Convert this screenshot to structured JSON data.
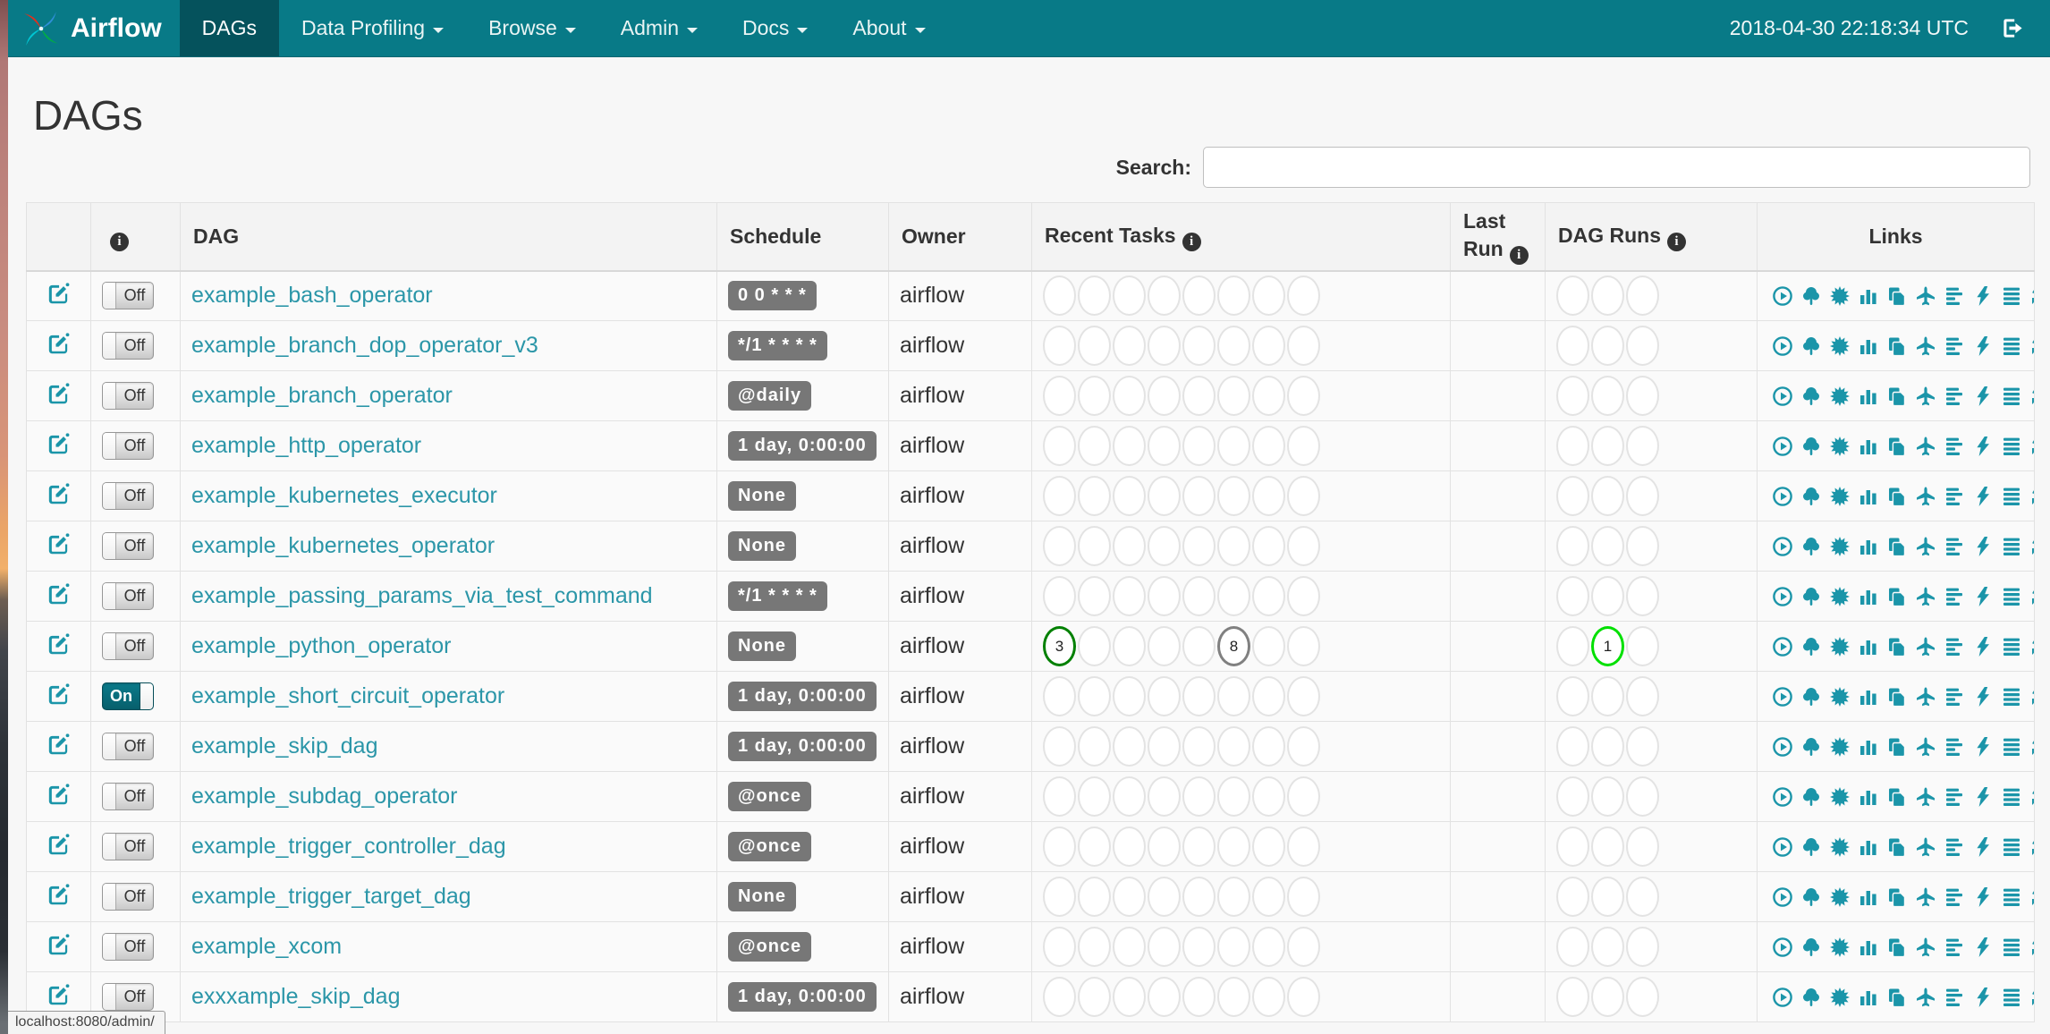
{
  "navbar": {
    "brand": "Airflow",
    "items": [
      {
        "label": "DAGs",
        "active": true,
        "caret": false
      },
      {
        "label": "Data Profiling",
        "active": false,
        "caret": true
      },
      {
        "label": "Browse",
        "active": false,
        "caret": true
      },
      {
        "label": "Admin",
        "active": false,
        "caret": true
      },
      {
        "label": "Docs",
        "active": false,
        "caret": true
      },
      {
        "label": "About",
        "active": false,
        "caret": true
      }
    ],
    "clock": "2018-04-30 22:18:34 UTC"
  },
  "page": {
    "title": "DAGs",
    "search_label": "Search:"
  },
  "colors": {
    "navbar_teal": "#087a87",
    "active_tab_teal": "#05525c",
    "link_teal": "#2b96a8",
    "icon_teal": "#1b95a9",
    "badge_gray": "#777777",
    "success_green": "#008000",
    "running_lime": "#00e000",
    "queued_gray": "#808080"
  },
  "table": {
    "headers": {
      "info": "i",
      "dag": "DAG",
      "schedule": "Schedule",
      "owner": "Owner",
      "recent_tasks": "Recent Tasks",
      "last_run_line1": "Last",
      "last_run_line2": "Run",
      "dag_runs": "DAG Runs",
      "links": "Links"
    },
    "recent_task_slots": 8,
    "dag_run_slots": 3,
    "links": [
      "trigger-dag-icon",
      "tree-view-icon",
      "graph-view-icon",
      "task-duration-icon",
      "task-tries-icon",
      "landing-times-icon",
      "gantt-icon",
      "code-view-icon",
      "dag-details-icon",
      "refresh-icon"
    ],
    "rows": [
      {
        "name": "example_bash_operator",
        "toggle": "Off",
        "schedule": "0 0 * * *",
        "owner": "airflow",
        "last_run": "",
        "recent_tasks": [],
        "dag_runs": []
      },
      {
        "name": "example_branch_dop_operator_v3",
        "toggle": "Off",
        "schedule": "*/1 * * * *",
        "owner": "airflow",
        "last_run": "",
        "recent_tasks": [],
        "dag_runs": []
      },
      {
        "name": "example_branch_operator",
        "toggle": "Off",
        "schedule": "@daily",
        "owner": "airflow",
        "last_run": "",
        "recent_tasks": [],
        "dag_runs": []
      },
      {
        "name": "example_http_operator",
        "toggle": "Off",
        "schedule": "1 day, 0:00:00",
        "owner": "airflow",
        "last_run": "",
        "recent_tasks": [],
        "dag_runs": []
      },
      {
        "name": "example_kubernetes_executor",
        "toggle": "Off",
        "schedule": "None",
        "owner": "airflow",
        "last_run": "",
        "recent_tasks": [],
        "dag_runs": []
      },
      {
        "name": "example_kubernetes_operator",
        "toggle": "Off",
        "schedule": "None",
        "owner": "airflow",
        "last_run": "",
        "recent_tasks": [],
        "dag_runs": []
      },
      {
        "name": "example_passing_params_via_test_command",
        "toggle": "Off",
        "schedule": "*/1 * * * *",
        "owner": "airflow",
        "last_run": "",
        "recent_tasks": [],
        "dag_runs": []
      },
      {
        "name": "example_python_operator",
        "toggle": "Off",
        "schedule": "None",
        "owner": "airflow",
        "last_run": "",
        "recent_tasks": [
          {
            "slot": 0,
            "count": "3",
            "color": "#008000"
          },
          {
            "slot": 5,
            "count": "8",
            "color": "#808080"
          }
        ],
        "dag_runs": [
          {
            "slot": 1,
            "count": "1",
            "color": "#00e000"
          }
        ]
      },
      {
        "name": "example_short_circuit_operator",
        "toggle": "On",
        "schedule": "1 day, 0:00:00",
        "owner": "airflow",
        "last_run": "",
        "recent_tasks": [],
        "dag_runs": []
      },
      {
        "name": "example_skip_dag",
        "toggle": "Off",
        "schedule": "1 day, 0:00:00",
        "owner": "airflow",
        "last_run": "",
        "recent_tasks": [],
        "dag_runs": []
      },
      {
        "name": "example_subdag_operator",
        "toggle": "Off",
        "schedule": "@once",
        "owner": "airflow",
        "last_run": "",
        "recent_tasks": [],
        "dag_runs": []
      },
      {
        "name": "example_trigger_controller_dag",
        "toggle": "Off",
        "schedule": "@once",
        "owner": "airflow",
        "last_run": "",
        "recent_tasks": [],
        "dag_runs": []
      },
      {
        "name": "example_trigger_target_dag",
        "toggle": "Off",
        "schedule": "None",
        "owner": "airflow",
        "last_run": "",
        "recent_tasks": [],
        "dag_runs": []
      },
      {
        "name": "example_xcom",
        "toggle": "Off",
        "schedule": "@once",
        "owner": "airflow",
        "last_run": "",
        "recent_tasks": [],
        "dag_runs": []
      },
      {
        "name": "exxxample_skip_dag",
        "toggle": "Off",
        "schedule": "1 day, 0:00:00",
        "owner": "airflow",
        "last_run": "",
        "recent_tasks": [],
        "dag_runs": []
      }
    ]
  },
  "status_bar": "localhost:8080/admin/"
}
